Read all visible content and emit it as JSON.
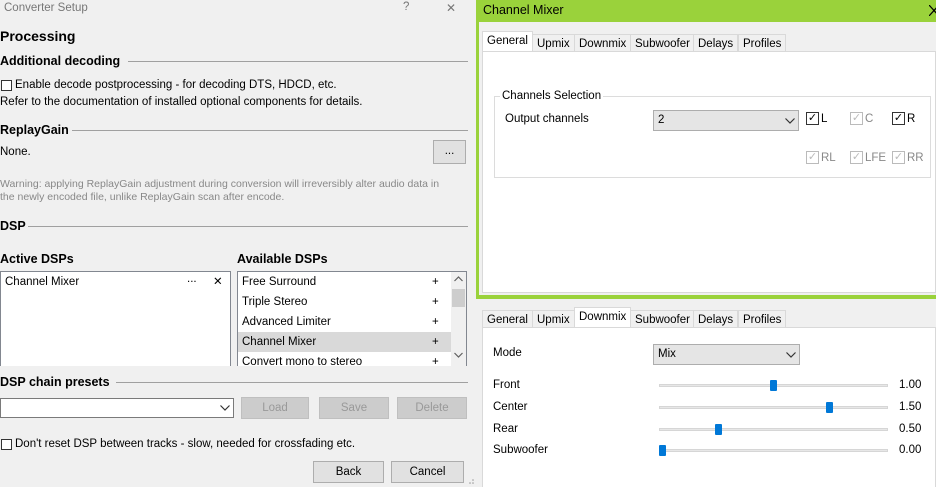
{
  "left": {
    "window_title": "Converter Setup",
    "help_glyph": "?",
    "close_glyph": "✕",
    "page_title": "Processing",
    "additional_decoding": {
      "heading": "Additional decoding",
      "checkbox_label": "Enable decode postprocessing - for decoding DTS, HDCD, etc.",
      "note": "Refer to the documentation of installed optional components for details."
    },
    "replaygain": {
      "heading": "ReplayGain",
      "value": "None.",
      "button": "...",
      "warning_line1": "Warning: applying ReplayGain adjustment during conversion will irreversibly alter audio data in",
      "warning_line2": "the newly encoded file, unlike ReplayGain scan after encode."
    },
    "dsp": {
      "heading": "DSP",
      "active_heading": "Active DSPs",
      "available_heading": "Available DSPs",
      "active_items": [
        {
          "label": "Channel Mixer",
          "config": "...",
          "remove": "✕"
        }
      ],
      "available_items": [
        {
          "label": "Free Surround",
          "add": "+"
        },
        {
          "label": "Triple Stereo",
          "add": "+"
        },
        {
          "label": "Advanced Limiter",
          "add": "+"
        },
        {
          "label": "Channel Mixer",
          "add": "+"
        },
        {
          "label": "Convert mono to stereo",
          "add": "+"
        }
      ]
    },
    "presets": {
      "heading": "DSP chain presets",
      "combo_value": "",
      "load": "Load",
      "save": "Save",
      "delete": "Delete"
    },
    "no_reset_label": "Don't reset DSP between tracks - slow, needed for crossfading etc.",
    "back": "Back",
    "cancel": "Cancel"
  },
  "channel_mixer": {
    "title": "Channel Mixer",
    "accent": "#9ad23b",
    "tabs": [
      "General",
      "Upmix",
      "Downmix",
      "Subwoofer",
      "Delays",
      "Profiles"
    ],
    "top_selected_tab": "General",
    "channels_group": "Channels Selection",
    "output_label": "Output channels",
    "output_value": "2",
    "channels": [
      {
        "label": "L",
        "checked": true,
        "enabled": true
      },
      {
        "label": "C",
        "checked": true,
        "enabled": false
      },
      {
        "label": "R",
        "checked": true,
        "enabled": true
      },
      {
        "label": "RL",
        "checked": true,
        "enabled": false
      },
      {
        "label": "LFE",
        "checked": true,
        "enabled": false
      },
      {
        "label": "RR",
        "checked": true,
        "enabled": false
      }
    ],
    "bottom_selected_tab": "Downmix",
    "mode_label": "Mode",
    "mode_value": "Mix",
    "sliders": [
      {
        "label": "Front",
        "value": "1.00",
        "fraction": 0.5
      },
      {
        "label": "Center",
        "value": "1.50",
        "fraction": 0.75
      },
      {
        "label": "Rear",
        "value": "0.50",
        "fraction": 0.25
      },
      {
        "label": "Subwoofer",
        "value": "0.00",
        "fraction": 0.0
      }
    ]
  }
}
